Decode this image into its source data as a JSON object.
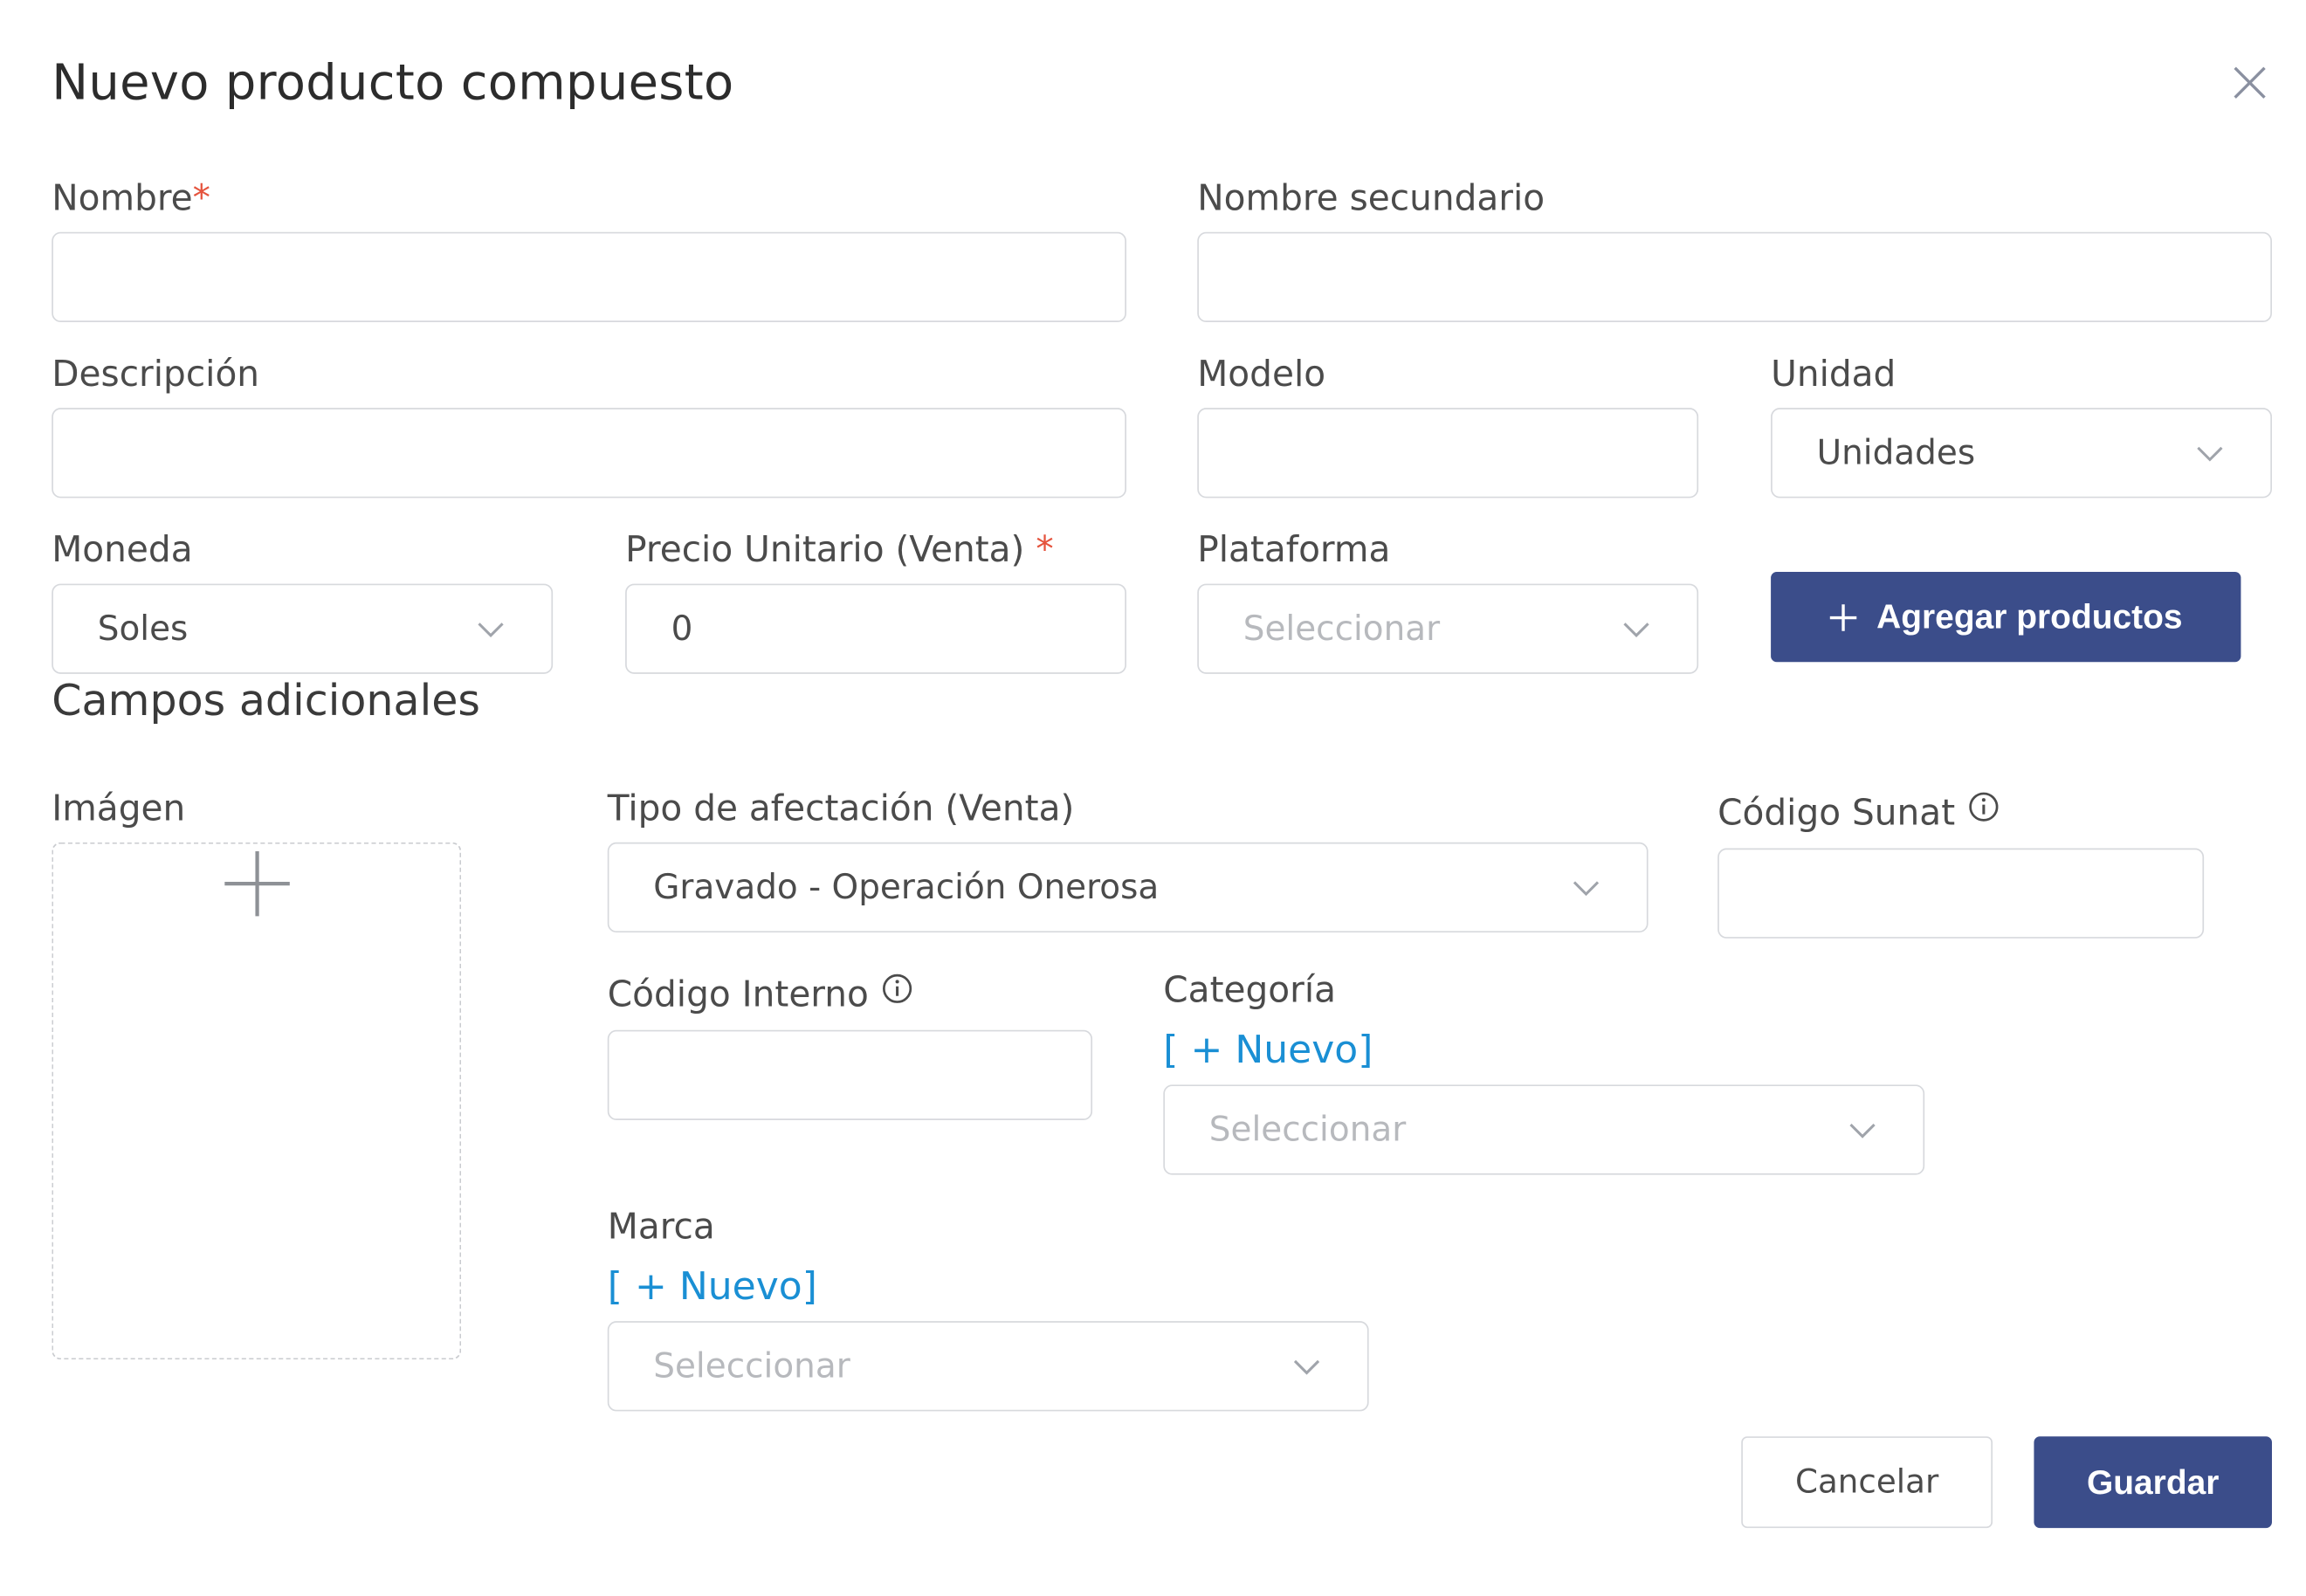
{
  "dialog": {
    "title": "Nuevo producto compuesto"
  },
  "fields": {
    "nombre": {
      "label": "Nombre",
      "required_mark": "*",
      "value": ""
    },
    "nombre_secundario": {
      "label": "Nombre secundario",
      "value": ""
    },
    "descripcion": {
      "label": "Descripción",
      "value": ""
    },
    "modelo": {
      "label": "Modelo",
      "value": ""
    },
    "unidad": {
      "label": "Unidad",
      "value": "Unidades"
    },
    "moneda": {
      "label": "Moneda",
      "value": "Soles"
    },
    "precio": {
      "label": "Precio Unitario (Venta)",
      "required_mark": "*",
      "value": "0"
    },
    "plataforma": {
      "label": "Plataforma",
      "placeholder": "Seleccionar"
    }
  },
  "agregar_productos": {
    "label": "Agregar productos"
  },
  "adicionales": {
    "section_title": "Campos adicionales",
    "imagen": {
      "label": "Imágen"
    },
    "tipo_afectacion": {
      "label": "Tipo de afectación (Venta)",
      "value": "Gravado - Operación Onerosa"
    },
    "codigo_sunat": {
      "label": "Código Sunat",
      "value": ""
    },
    "codigo_interno": {
      "label": "Código Interno",
      "value": ""
    },
    "categoria": {
      "label": "Categoría",
      "nuevo": "[ + Nuevo]",
      "placeholder": "Seleccionar"
    },
    "marca": {
      "label": "Marca",
      "nuevo": "[ + Nuevo]",
      "placeholder": "Seleccionar"
    }
  },
  "footer": {
    "cancel_label": "Cancelar",
    "save_label": "Guardar"
  },
  "colors": {
    "primary": "#3b4d8a",
    "link": "#1a8fd4",
    "required": "#e5533d",
    "border": "#d7d9dd"
  }
}
